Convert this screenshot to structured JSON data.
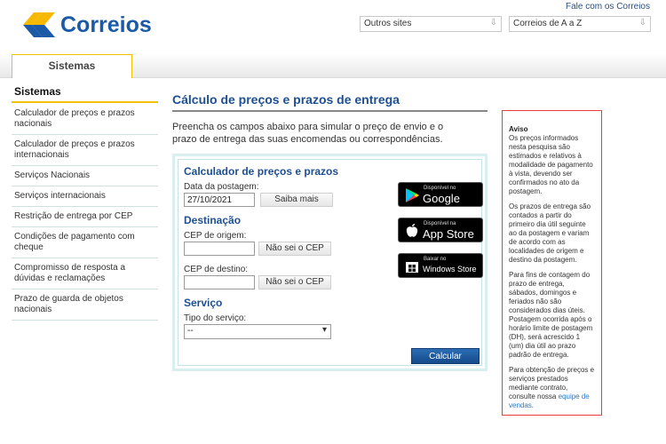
{
  "brand": {
    "name": "Correios",
    "logo_colors": {
      "yellow": "#f6b800",
      "blue": "#1b5aa6"
    }
  },
  "header": {
    "top_link": "Fale com os Correios",
    "select_outros": "Outros sites",
    "select_correios": "Correios de A a Z"
  },
  "nav": {
    "tab_label": "Sistemas"
  },
  "sidebar": {
    "title": "Sistemas",
    "items": [
      {
        "label": "Calculador de preços e prazos nacionais"
      },
      {
        "label": "Calculador de preços e prazos internacionais"
      },
      {
        "label": "Serviços Nacionais"
      },
      {
        "label": "Serviços internacionais"
      },
      {
        "label": "Restrição de entrega por CEP"
      },
      {
        "label": "Condições de pagamento com cheque"
      },
      {
        "label": "Compromisso de resposta a dúvidas e reclamações"
      },
      {
        "label": "Prazo de guarda de objetos nacionais"
      }
    ]
  },
  "main": {
    "title": "Cálculo de preços e prazos de entrega",
    "intro": "Preencha os campos abaixo para simular o preço de envio e o prazo de entrega das suas encomendas ou correspondências."
  },
  "calculator": {
    "title": "Calculador de preços e prazos",
    "date_label": "Data da postagem:",
    "date_value": "27/10/2021",
    "saiba_mais": "Saiba mais",
    "destino_title": "Destinação",
    "origem_label": "CEP de origem:",
    "origem_value": "",
    "destino_label": "CEP de destino:",
    "destino_value": "",
    "nao_sei_cep": "Não sei o CEP",
    "servico_title": "Serviço",
    "tipo_label": "Tipo do serviço:",
    "tipo_value": "--",
    "calcular": "Calcular"
  },
  "stores": {
    "google": {
      "small": "Disponível no",
      "big": "Google play"
    },
    "apple": {
      "small": "Disponível na",
      "big": "App Store"
    },
    "windows": {
      "small": "Baixar no",
      "big": "Windows Store"
    }
  },
  "aviso": {
    "title": "Aviso",
    "p1": "Os preços informados nesta pesquisa são estimados e relativos à modalidade de pagamento à vista, devendo ser confirmados no ato da postagem.",
    "p2": "Os prazos de entrega são contados a partir do primeiro dia útil seguinte ao da postagem e variam de acordo com as localidades de origem e destino da postagem.",
    "p3": "Para fins de contagem do prazo de entrega, sábados, domingos e feriados não são considerados dias úteis. Postagem ocorrida após o horário limite de postagem (DH), será acrescido 1 (um) dia útil ao prazo padrão de entrega.",
    "p4_pre": "Para obtenção de preços e serviços prestados mediante contrato, consulte nossa ",
    "p4_link": "equipe de vendas",
    "p4_post": "."
  },
  "colors": {
    "accent_blue": "#1d4f91",
    "accent_yellow": "#f2c200",
    "aviso_border": "#e53b3b",
    "button_blue": "#154a8a"
  }
}
